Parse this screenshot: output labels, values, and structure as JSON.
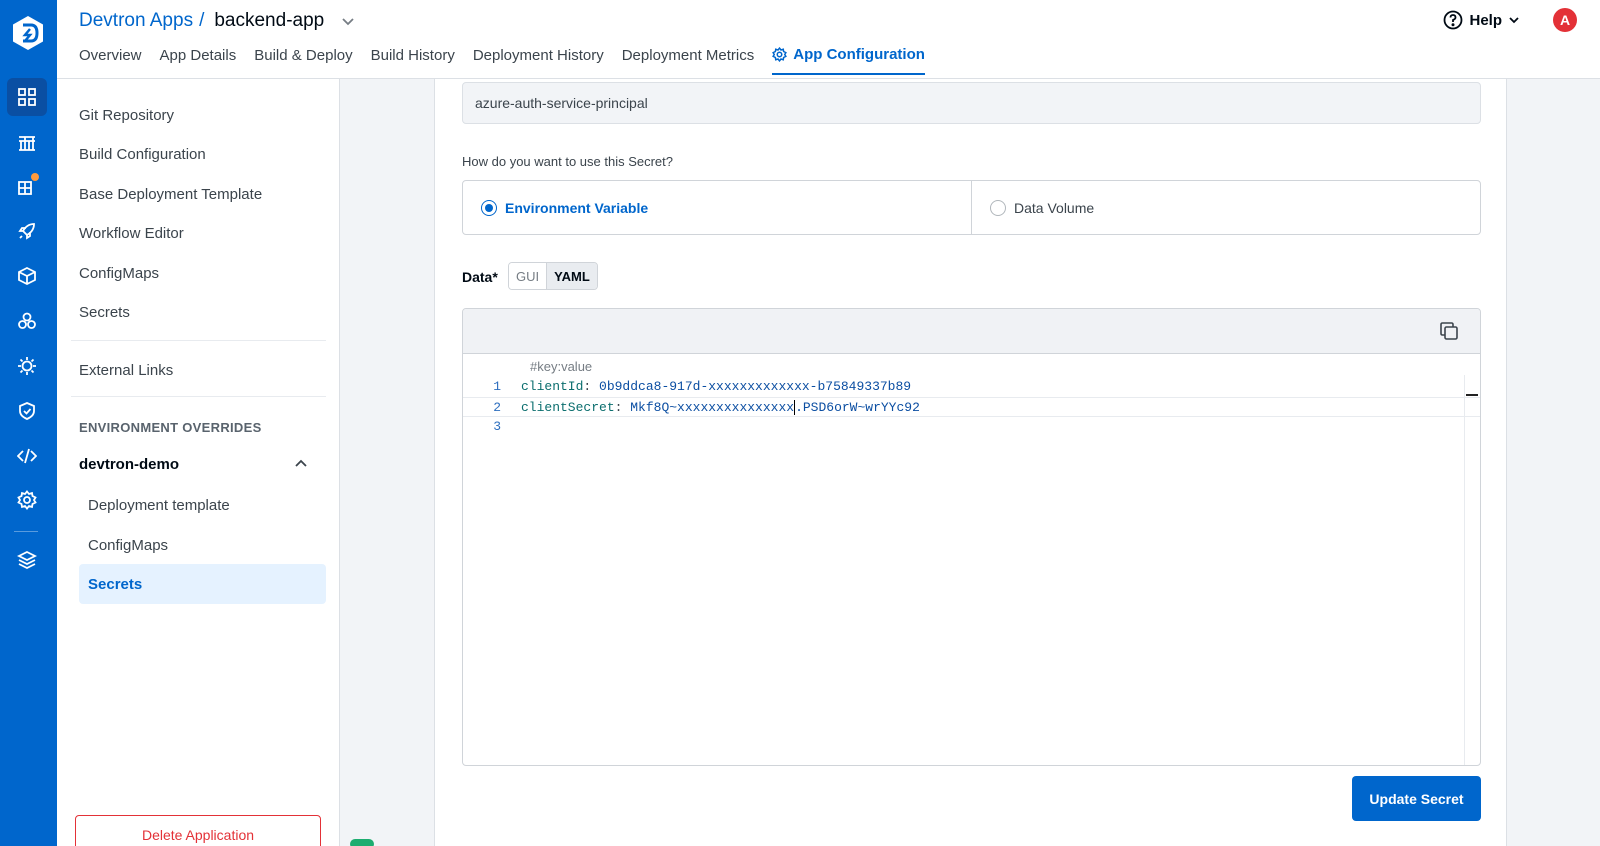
{
  "header": {
    "breadcrumb_parent": "Devtron Apps",
    "breadcrumb_sep": "/",
    "app_name": "backend-app",
    "help_label": "Help",
    "avatar_initial": "A",
    "tabs": [
      {
        "label": "Overview"
      },
      {
        "label": "App Details"
      },
      {
        "label": "Build & Deploy"
      },
      {
        "label": "Build History"
      },
      {
        "label": "Deployment History"
      },
      {
        "label": "Deployment Metrics"
      },
      {
        "label": "App Configuration"
      }
    ]
  },
  "rail": {
    "icons": [
      "devtron-logo-icon",
      "dashboard-grid-icon",
      "chart-store-icon",
      "app-groups-icon",
      "deploy-rocket-icon",
      "cube-icon",
      "clusters-icon",
      "bug-settings-icon",
      "shield-icon",
      "code-icon",
      "gear-icon",
      "stack-icon"
    ],
    "colors": {
      "rail": "#0066cc",
      "notification": "#ff9b3d"
    }
  },
  "sidebar": {
    "items": [
      "Git Repository",
      "Build Configuration",
      "Base Deployment Template",
      "Workflow Editor",
      "ConfigMaps",
      "Secrets"
    ],
    "external_links": "External Links",
    "env_section_title": "ENVIRONMENT OVERRIDES",
    "env_name": "devtron-demo",
    "env_items": [
      "Deployment template",
      "ConfigMaps",
      "Secrets"
    ],
    "delete_label": "Delete Application"
  },
  "secret_form": {
    "name_value": "azure-auth-service-principal",
    "usage_question": "How do you want to use this Secret?",
    "options": [
      "Environment Variable",
      "Data Volume"
    ],
    "selected_option": "Environment Variable",
    "data_label": "Data*",
    "mode_gui": "GUI",
    "mode_yaml": "YAML",
    "editor_placeholder": "#key:value",
    "lines": [
      {
        "num": "1",
        "key": "clientId",
        "value": "0b9ddca8-917d-xxxxxxxxxxxxx-b75849337b89"
      },
      {
        "num": "2",
        "key": "clientSecret",
        "value_before_caret": "Mkf8Q~xxxxxxxxxxxxxxx",
        "value_after_caret": ".PSD6orW~wrYYc92"
      },
      {
        "num": "3"
      }
    ],
    "update_label": "Update Secret"
  }
}
